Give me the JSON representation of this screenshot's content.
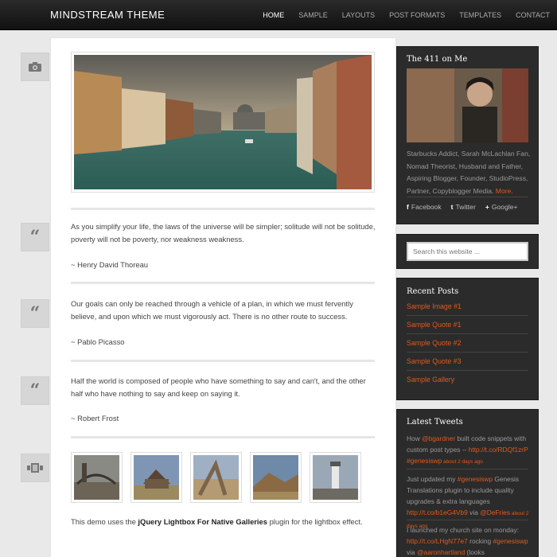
{
  "header": {
    "site_title": "MINDSTREAM THEME",
    "nav": [
      "HOME",
      "SAMPLE",
      "LAYOUTS",
      "POST FORMATS",
      "TEMPLATES",
      "CONTACT"
    ],
    "active": "HOME"
  },
  "left_icons": [
    "camera-icon",
    "quote-icon",
    "quote-icon",
    "quote-icon",
    "gallery-icon"
  ],
  "quotes": [
    {
      "text": "As you simplify your life, the laws of the universe will be simpler; solitude will not be solitude, poverty will not be poverty, nor weakness weakness.",
      "author": "~ Henry David Thoreau"
    },
    {
      "text": "Our goals can only be reached through a vehicle of a plan, in which we must fervently believe, and upon which we must vigorously act. There is no other route to success.",
      "author": "~ Pablo Picasso"
    },
    {
      "text": "Half the world is composed of people who have something to say and can't, and the other half who have nothing to say and keep on saying it.",
      "author": "~ Robert Frost"
    }
  ],
  "gallery_note": {
    "before": "This demo uses the ",
    "bold": "jQuery Lightbox For Native Galleries",
    "after": " plugin for the lightbox effect."
  },
  "sidebar": {
    "about": {
      "title": "The 411 on Me",
      "text": "Starbucks Addict, Sarah McLachlan Fan, Nomad Theorist, Husband and Father, Aspiring Blogger, Founder, StudioPress, Partner, Copyblogger Media.",
      "more": "More.",
      "social": [
        {
          "icon": "f",
          "label": "Facebook"
        },
        {
          "icon": "t",
          "label": "Twitter"
        },
        {
          "icon": "+",
          "label": "Google+"
        }
      ]
    },
    "search": {
      "placeholder": "Search this website ..."
    },
    "recent": {
      "title": "Recent Posts",
      "items": [
        "Sample Image #1",
        "Sample Quote #1",
        "Sample Quote #2",
        "Sample Quote #3",
        "Sample Gallery"
      ]
    },
    "tweets": {
      "title": "Latest Tweets",
      "items": [
        {
          "a": "How ",
          "b": "@bgardner",
          "c": " built code snippets with custom post types -- ",
          "d": "http://t.co/RDQf1zrP",
          "e": " ",
          "f": "#genesiswp",
          "ts": " about 2 days ago"
        },
        {
          "a": "Just updated my ",
          "b": "#genesiswp",
          "c": " Genesis Translations plugin to include quality upgrades & extra languages ",
          "d": "http://t.co/b1eG4Vb9",
          "e": " via ",
          "f": "@DeFries",
          "ts": " about 2 days ago"
        },
        {
          "a": "I launched my church site on monday: ",
          "b": "http://t.co/LHgN77e7",
          "c": " rocking ",
          "d": "#genesiswp",
          "e": " via ",
          "f": "@aaronhartland",
          "ts": " (looks"
        }
      ]
    }
  },
  "colors": {
    "accent": "#e05a1c",
    "sidebar_bg": "#2b2b2b",
    "page_bg": "#e9e9e9"
  }
}
